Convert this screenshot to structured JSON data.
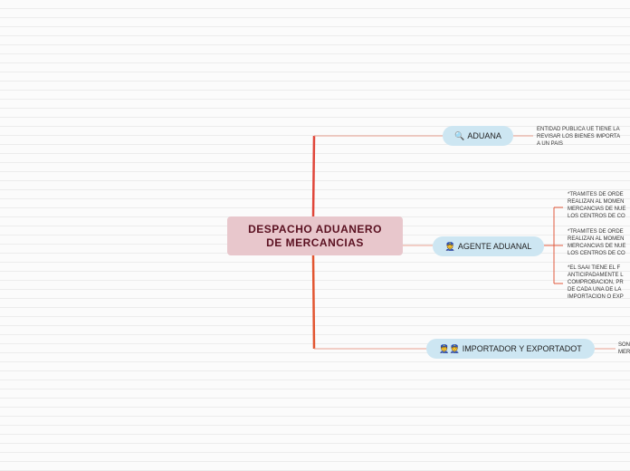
{
  "root": {
    "line1": "DESPACHO ADUANERO",
    "line2": "DE MERCANCIAS"
  },
  "branches": [
    {
      "icon": "magnifier-icon",
      "icon_glyph": "🔍",
      "label": "ADUANA",
      "descriptions": [
        "ENTIDAD PUBLICA UE TIENE LA\nREVISAR LOS BIENES IMPORTA\nA UN PAIS"
      ]
    },
    {
      "icon": "officer-icon",
      "icon_glyph": "👮",
      "label": "AGENTE ADUANAL",
      "descriptions": [
        "*TRAMITES DE ORDE\nREALIZAN AL MOMEN\nMERCANCIAS DE NUE\nLOS CENTROS DE CO",
        "*TRAMITES DE ORDE\nREALIZAN AL MOMEN\nMERCANCIAS DE NUE\nLOS CENTROS DE CO",
        "*EL SAAI TIENE EL F\nANTICIPADAMENTE L\nCOMPROBACION, PR\nDE CADA UNA DE LA\nIMPORTACION O EXP"
      ]
    },
    {
      "icon": "officers-icon",
      "icon_glyph": "👮👮",
      "label": "IMPORTADOR Y EXPORTADOT",
      "descriptions": [
        "SON\nMER"
      ]
    }
  ],
  "colors": {
    "root_bg": "#e8c7cc",
    "node_bg": "#cde6f2",
    "connector": "#e05a3c",
    "root_text": "#5a1020"
  }
}
